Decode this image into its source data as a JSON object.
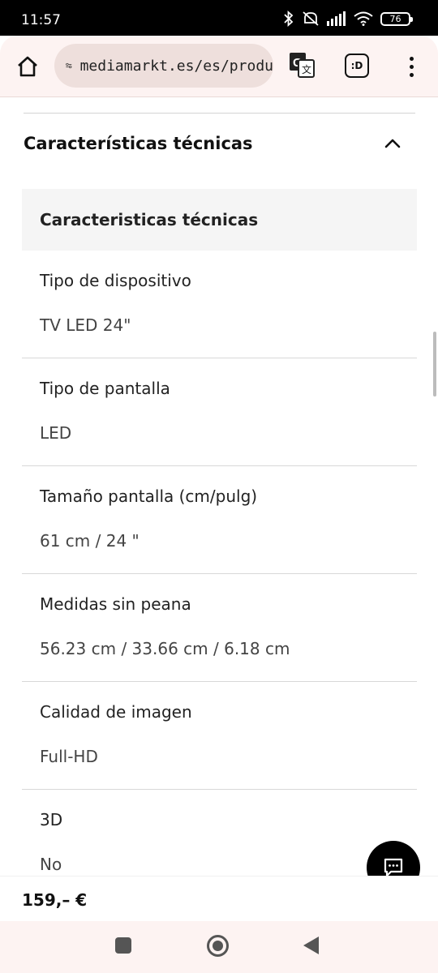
{
  "status_bar": {
    "time": "11:57",
    "battery": "76"
  },
  "browser": {
    "url": "mediamarkt.es/es/produ",
    "tabs_label": ":D"
  },
  "section": {
    "title": "Características técnicas",
    "subtitle": "Caracteristicas técnicas"
  },
  "specs": [
    {
      "label": "Tipo de dispositivo",
      "value": "TV LED 24\""
    },
    {
      "label": "Tipo de pantalla",
      "value": "LED"
    },
    {
      "label": "Tamaño pantalla (cm/pulg)",
      "value": "61 cm / 24 \""
    },
    {
      "label": "Medidas sin peana",
      "value": "56.23 cm / 33.66 cm / 6.18 cm"
    },
    {
      "label": "Calidad de imagen",
      "value": "Full-HD"
    },
    {
      "label": "3D",
      "value": "No"
    }
  ],
  "footer": {
    "price": "159,– €"
  }
}
